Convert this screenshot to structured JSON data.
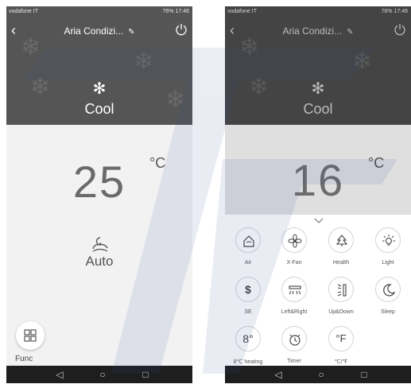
{
  "status": {
    "carrier": "vodafone IT",
    "right": "76% 17:46"
  },
  "left": {
    "title": "Aria Condizi...",
    "mode": "Cool",
    "temperature": "25",
    "unit": "°C",
    "fan": "Auto",
    "func": "Func"
  },
  "right": {
    "title": "Aria Condizi...",
    "mode": "Cool",
    "temperature": "16",
    "unit": "°C",
    "functions": [
      {
        "label": "Air",
        "icon": "air-icon"
      },
      {
        "label": "X-Fan",
        "icon": "x-fan-icon"
      },
      {
        "label": "Health",
        "icon": "health-icon"
      },
      {
        "label": "Light",
        "icon": "light-icon"
      },
      {
        "label": "SE",
        "icon": "se-dollar-icon"
      },
      {
        "label": "Left&Right",
        "icon": "left-right-swing-icon"
      },
      {
        "label": "Up&Down",
        "icon": "up-down-swing-icon"
      },
      {
        "label": "Sleep",
        "icon": "sleep-icon"
      },
      {
        "label": "8℃ heating",
        "icon": "heating-8c-icon",
        "glyph": "8°"
      },
      {
        "label": "Timer",
        "icon": "timer-icon"
      },
      {
        "label": "℃/℉",
        "icon": "unit-switch-icon",
        "glyph": "°F"
      }
    ]
  },
  "colors": {
    "header_bg": "#555555",
    "body_bg": "#f2f2f2",
    "navbar_bg": "#1e1e1e",
    "watermark": "#3a4fa0"
  }
}
